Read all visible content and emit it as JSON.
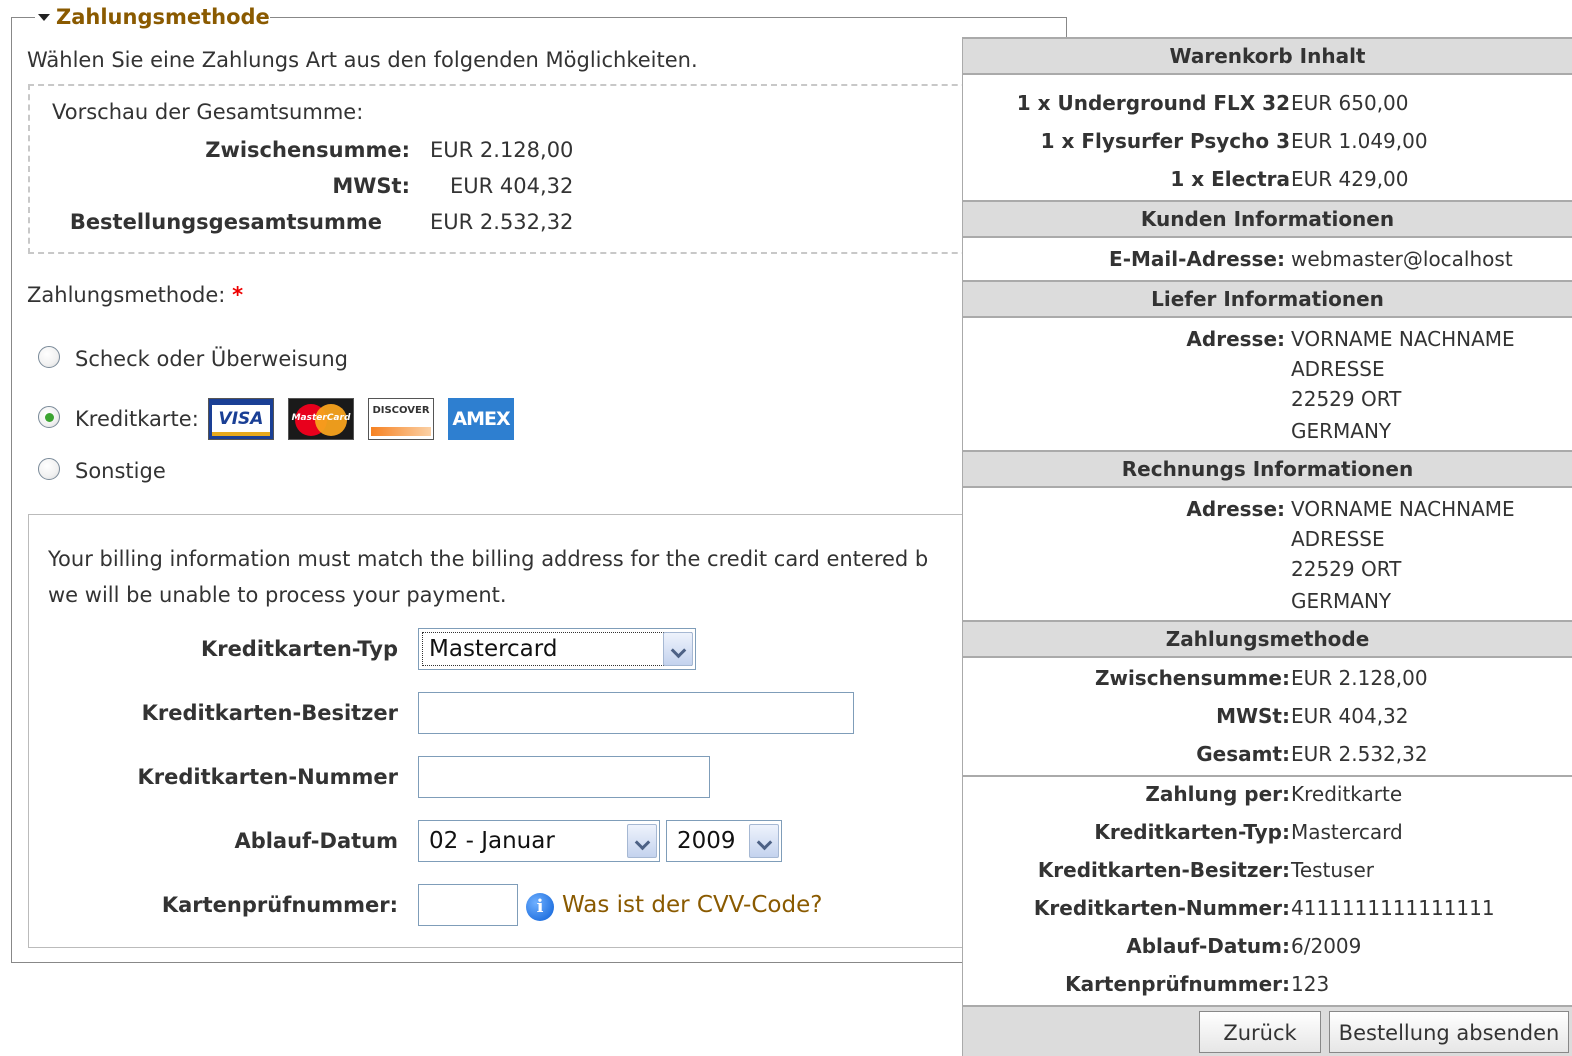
{
  "payment_form": {
    "legend": "Zahlungsmethode",
    "intro": "Wählen Sie eine Zahlungs Art aus den folgenden Möglichkeiten.",
    "preview": {
      "title": "Vorschau der Gesamtsumme:",
      "rows": [
        {
          "label": "Zwischensumme:",
          "value": "EUR 2.128,00"
        },
        {
          "label": "MWSt:",
          "value": "EUR 404,32"
        },
        {
          "label": "Bestellungsgesamtsumme",
          "value": "EUR 2.532,32"
        }
      ]
    },
    "method_label": "Zahlungsmethode:",
    "required_mark": "*",
    "options": [
      {
        "label": "Scheck oder Überweisung",
        "checked": false
      },
      {
        "label": "Kreditkarte:",
        "checked": true
      },
      {
        "label": "Sonstige",
        "checked": false
      }
    ],
    "card_logos": [
      {
        "name": "VISA",
        "icon": "visa-logo"
      },
      {
        "name": "MasterCard",
        "icon": "mastercard-logo"
      },
      {
        "name": "DISCOVER",
        "icon": "discover-logo"
      },
      {
        "name": "AMEX",
        "icon": "amex-logo"
      }
    ],
    "credit_card": {
      "info_line1": "Your billing information must match the billing address for the credit card entered b",
      "info_line2": "we will be unable to process your payment.",
      "type_label": "Kreditkarten-Typ",
      "type_value": "Mastercard",
      "owner_label": "Kreditkarten-Besitzer",
      "owner_value": "",
      "number_label": "Kreditkarten-Nummer",
      "number_value": "",
      "expiry_label": "Ablauf-Datum",
      "expiry_month": "02 - Januar",
      "expiry_year": "2009",
      "cvv_label": "Kartenprüfnummer:",
      "cvv_value": "",
      "cvv_link": "Was ist der CVV-Code?"
    }
  },
  "summary": {
    "cart_header": "Warenkorb Inhalt",
    "cart_items": [
      {
        "name": "1 x Underground FLX 32",
        "price": "EUR 650,00"
      },
      {
        "name": "1 x Flysurfer Psycho 3",
        "price": "EUR 1.049,00"
      },
      {
        "name": "1 x Electra",
        "price": "EUR 429,00"
      }
    ],
    "customer_header": "Kunden Informationen",
    "email_label": "E-Mail-Adresse:",
    "email_value": "webmaster@localhost",
    "shipping_header": "Liefer Informationen",
    "shipping_label": "Adresse:",
    "shipping_lines": [
      "VORNAME NACHNAME",
      "ADRESSE",
      "22529 ORT",
      "GERMANY"
    ],
    "billing_header": "Rechnungs Informationen",
    "billing_label": "Adresse:",
    "billing_lines": [
      "VORNAME NACHNAME",
      "ADRESSE",
      "22529 ORT",
      "GERMANY"
    ],
    "payment_header": "Zahlungsmethode",
    "totals": [
      {
        "label": "Zwischensumme:",
        "value": "EUR 2.128,00"
      },
      {
        "label": "MWSt:",
        "value": "EUR 404,32"
      },
      {
        "label": "Gesamt:",
        "value": "EUR 2.532,32"
      }
    ],
    "payment_details": [
      {
        "label": "Zahlung per:",
        "value": "Kreditkarte"
      },
      {
        "label": "Kreditkarten-Typ:",
        "value": "Mastercard"
      },
      {
        "label": "Kreditkarten-Besitzer:",
        "value": "Testuser"
      },
      {
        "label": "Kreditkarten-Nummer:",
        "value": "4111111111111111"
      },
      {
        "label": "Ablauf-Datum:",
        "value": "6/2009"
      },
      {
        "label": "Kartenprüfnummer:",
        "value": "123"
      }
    ],
    "back_button": "Zurück",
    "submit_button": "Bestellung absenden"
  }
}
